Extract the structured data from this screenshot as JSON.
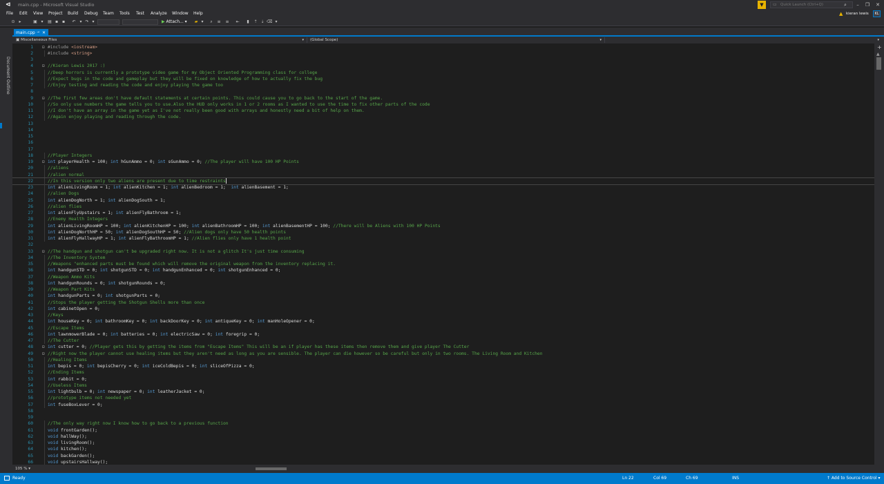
{
  "window": {
    "title": "main.cpp - Microsoft Visual Studio",
    "quick_launch_placeholder": "Quick Launch (Ctrl+Q)",
    "user_name": "kieran lewis",
    "user_initials": "KL",
    "controls": {
      "minimize": "–",
      "restore": "❐",
      "close": "✕"
    }
  },
  "menu": [
    "File",
    "Edit",
    "View",
    "Project",
    "Build",
    "Debug",
    "Team",
    "Tools",
    "Test",
    "Analyze",
    "Window",
    "Help"
  ],
  "toolbar": {
    "attach_label": "Attach..."
  },
  "side_panel": {
    "label": "Document Outline"
  },
  "tab": {
    "label": "main.cpp",
    "pin": "⊸",
    "close": "✕"
  },
  "navigation": {
    "project": "Miscellaneous Files",
    "scope": "(Global Scope)"
  },
  "editor": {
    "current_line": 22,
    "lines": [
      {
        "n": 1,
        "fold": "⊟",
        "tokens": [
          [
            "pp",
            "#include "
          ],
          [
            "st",
            "<iostream>"
          ]
        ]
      },
      {
        "n": 2,
        "fold": "",
        "tokens": [
          [
            "pp",
            "#include "
          ],
          [
            "st",
            "<string>"
          ]
        ]
      },
      {
        "n": 3,
        "fold": "",
        "tokens": []
      },
      {
        "n": 4,
        "fold": "⊟",
        "tokens": [
          [
            "cm",
            "//Kieran Lewis 2017 :)"
          ]
        ]
      },
      {
        "n": 5,
        "fold": "",
        "tokens": [
          [
            "cm",
            "//Deep horrors is currently a prototype video game for my Object Oriented Programming class for college"
          ]
        ]
      },
      {
        "n": 6,
        "fold": "",
        "tokens": [
          [
            "cm",
            "//Expect bugs in the code and gameplay but they will be fixed on knowledge of how to actually fix the bug"
          ]
        ]
      },
      {
        "n": 7,
        "fold": "",
        "tokens": [
          [
            "cm",
            "//Enjoy testing and reading the code and enjoy playing the game too"
          ]
        ]
      },
      {
        "n": 8,
        "fold": "",
        "tokens": []
      },
      {
        "n": 9,
        "fold": "⊟",
        "tokens": [
          [
            "cm",
            "//The first few areas don't have default statements at certain points. This could cause you to go back to the start of the game."
          ]
        ]
      },
      {
        "n": 10,
        "fold": "",
        "tokens": [
          [
            "cm",
            "//So only use numbers the game tells you to use.Also the HUD only works in 1 or 2 rooms as I wanted to use the time to fix other parts of the code"
          ]
        ]
      },
      {
        "n": 11,
        "fold": "",
        "tokens": [
          [
            "cm",
            "//I don't have an array in the game yet as I've not really been good with arrays and honestly need a bit of help on them."
          ]
        ]
      },
      {
        "n": 12,
        "fold": "",
        "tokens": [
          [
            "cm",
            "//Again enjoy playing and reading through the code."
          ]
        ]
      },
      {
        "n": 13,
        "fold": "",
        "tokens": []
      },
      {
        "n": 14,
        "fold": "",
        "tokens": []
      },
      {
        "n": 15,
        "fold": "",
        "tokens": []
      },
      {
        "n": 16,
        "fold": "",
        "tokens": []
      },
      {
        "n": 17,
        "fold": "",
        "tokens": []
      },
      {
        "n": 18,
        "fold": "",
        "tokens": [
          [
            "cm",
            "//Player Integers"
          ]
        ]
      },
      {
        "n": 19,
        "fold": "⊟",
        "tokens": [
          [
            "kw",
            "int"
          ],
          [
            "pl",
            " playerHealth = 100; "
          ],
          [
            "kw",
            "int"
          ],
          [
            "pl",
            " hGunAmmo = 0; "
          ],
          [
            "kw",
            "int"
          ],
          [
            "pl",
            " sGunAmmo = 0; "
          ],
          [
            "cm",
            "//The player will have 100 HP Points"
          ]
        ]
      },
      {
        "n": 20,
        "fold": "",
        "tokens": [
          [
            "cm",
            "//aliens"
          ]
        ]
      },
      {
        "n": 21,
        "fold": "",
        "tokens": [
          [
            "cm",
            "//alien normal"
          ]
        ]
      },
      {
        "n": 22,
        "fold": "",
        "tokens": [
          [
            "cm",
            "//In this version only two aliens are present due to time restraints"
          ]
        ]
      },
      {
        "n": 23,
        "fold": "",
        "tokens": [
          [
            "kw",
            "int"
          ],
          [
            "pl",
            " alienLivingRoom = 1; "
          ],
          [
            "kw",
            "int"
          ],
          [
            "pl",
            " alienKitchen = 1; "
          ],
          [
            "kw",
            "int"
          ],
          [
            "pl",
            " alienBedroom = 1;  "
          ],
          [
            "kw",
            "int"
          ],
          [
            "pl",
            " alienBasement = 1;"
          ]
        ]
      },
      {
        "n": 24,
        "fold": "",
        "tokens": [
          [
            "cm",
            "//alien Dogs"
          ]
        ]
      },
      {
        "n": 25,
        "fold": "",
        "tokens": [
          [
            "kw",
            "int"
          ],
          [
            "pl",
            " alienDogNorth = 1; "
          ],
          [
            "kw",
            "int"
          ],
          [
            "pl",
            " alienDogSouth = 1;"
          ]
        ]
      },
      {
        "n": 26,
        "fold": "",
        "tokens": [
          [
            "cm",
            "//alien flies"
          ]
        ]
      },
      {
        "n": 27,
        "fold": "",
        "tokens": [
          [
            "kw",
            "int"
          ],
          [
            "pl",
            " alienFlyUpstairs = 1; "
          ],
          [
            "kw",
            "int"
          ],
          [
            "pl",
            " alienFlyBathroom = 1;"
          ]
        ]
      },
      {
        "n": 28,
        "fold": "",
        "tokens": [
          [
            "cm",
            "//Enemy Health Integers"
          ]
        ]
      },
      {
        "n": 29,
        "fold": "",
        "tokens": [
          [
            "kw",
            "int"
          ],
          [
            "pl",
            " alienLivingRoomHP = 100; "
          ],
          [
            "kw",
            "int"
          ],
          [
            "pl",
            " alienKitchenHP = 100; "
          ],
          [
            "kw",
            "int"
          ],
          [
            "pl",
            " alienBathroomHP = 100; "
          ],
          [
            "kw",
            "int"
          ],
          [
            "pl",
            " alienBasementHP = 100; "
          ],
          [
            "cm",
            "//There will be Aliens with 100 HP Points"
          ]
        ]
      },
      {
        "n": 30,
        "fold": "",
        "tokens": [
          [
            "kw",
            "int"
          ],
          [
            "pl",
            " alienDogNorthHP = 50; "
          ],
          [
            "kw",
            "int"
          ],
          [
            "pl",
            " alienDogSouthHP = 50; "
          ],
          [
            "cm",
            "//Alien dogs only have 50 health points"
          ]
        ]
      },
      {
        "n": 31,
        "fold": "",
        "tokens": [
          [
            "kw",
            "int"
          ],
          [
            "pl",
            " alienFlyHallwayHP = 1; "
          ],
          [
            "kw",
            "int"
          ],
          [
            "pl",
            " alienFlyBathroomHP = 1; "
          ],
          [
            "cm",
            "//Alien flies only have 1 health point"
          ]
        ]
      },
      {
        "n": 32,
        "fold": "",
        "tokens": []
      },
      {
        "n": 33,
        "fold": "⊟",
        "tokens": [
          [
            "cm",
            "//The handgun and shotgun can't be upgraded right now. It is not a glitch It's just time consuming"
          ]
        ]
      },
      {
        "n": 34,
        "fold": "",
        "tokens": [
          [
            "cm",
            "//The Inventory System"
          ]
        ]
      },
      {
        "n": 35,
        "fold": "",
        "tokens": [
          [
            "cm",
            "//Weapons \"enhanced parts must be found which will remove the original weapon from the inventory replacing it."
          ]
        ]
      },
      {
        "n": 36,
        "fold": "",
        "tokens": [
          [
            "kw",
            "int"
          ],
          [
            "pl",
            " handgunSTD = 0; "
          ],
          [
            "kw",
            "int"
          ],
          [
            "pl",
            " shotgunSTD = 0; "
          ],
          [
            "kw",
            "int"
          ],
          [
            "pl",
            " handgunEnhanced = 0; "
          ],
          [
            "kw",
            "int"
          ],
          [
            "pl",
            " shotgunEnhanced = 0;"
          ]
        ]
      },
      {
        "n": 37,
        "fold": "",
        "tokens": [
          [
            "cm",
            "//Weapon Ammo Kits"
          ]
        ]
      },
      {
        "n": 38,
        "fold": "",
        "tokens": [
          [
            "kw",
            "int"
          ],
          [
            "pl",
            " handgunRounds = 0; "
          ],
          [
            "kw",
            "int"
          ],
          [
            "pl",
            " shotgunRounds = 0;"
          ]
        ]
      },
      {
        "n": 39,
        "fold": "",
        "tokens": [
          [
            "cm",
            "//Weapon Part Kits"
          ]
        ]
      },
      {
        "n": 40,
        "fold": "",
        "tokens": [
          [
            "kw",
            "int"
          ],
          [
            "pl",
            " handgunParts = 0; "
          ],
          [
            "kw",
            "int"
          ],
          [
            "pl",
            " shotgunParts = 0;"
          ]
        ]
      },
      {
        "n": 41,
        "fold": "",
        "tokens": [
          [
            "cm",
            "//Stops the player getting the Shotgun Shells more than once"
          ]
        ]
      },
      {
        "n": 42,
        "fold": "",
        "tokens": [
          [
            "kw",
            "int"
          ],
          [
            "pl",
            " cabinetOpen = 0;"
          ]
        ]
      },
      {
        "n": 43,
        "fold": "",
        "tokens": [
          [
            "cm",
            "//Keys"
          ]
        ]
      },
      {
        "n": 44,
        "fold": "",
        "tokens": [
          [
            "kw",
            "int"
          ],
          [
            "pl",
            " houseKey = 0; "
          ],
          [
            "kw",
            "int"
          ],
          [
            "pl",
            " bathroomKey = 0; "
          ],
          [
            "kw",
            "int"
          ],
          [
            "pl",
            " backDoorKey = 0; "
          ],
          [
            "kw",
            "int"
          ],
          [
            "pl",
            " antiqueKey = 0; "
          ],
          [
            "kw",
            "int"
          ],
          [
            "pl",
            " manHoleOpener = 0;"
          ]
        ]
      },
      {
        "n": 45,
        "fold": "",
        "tokens": [
          [
            "cm",
            "//Escape Items"
          ]
        ]
      },
      {
        "n": 46,
        "fold": "",
        "tokens": [
          [
            "kw",
            "int"
          ],
          [
            "pl",
            " lawnmowerBlade = 0; "
          ],
          [
            "kw",
            "int"
          ],
          [
            "pl",
            " batteries = 0; "
          ],
          [
            "kw",
            "int"
          ],
          [
            "pl",
            " electricSaw = 0; "
          ],
          [
            "kw",
            "int"
          ],
          [
            "pl",
            " foregrip = 0;"
          ]
        ]
      },
      {
        "n": 47,
        "fold": "",
        "tokens": [
          [
            "cm",
            "//The Cutter"
          ]
        ]
      },
      {
        "n": 48,
        "fold": "⊟",
        "tokens": [
          [
            "kw",
            "int"
          ],
          [
            "pl",
            " cutter = 0; "
          ],
          [
            "cm",
            "//Player gets this by getting the items from \"Escape Items\" This will be an if player has these items then remove them and give player The Cutter"
          ]
        ]
      },
      {
        "n": 49,
        "fold": "⊟",
        "tokens": [
          [
            "cm",
            "//Right now the player cannot use healing items but they aren't need as long as you are sensible. The player can die however so be careful but only in two rooms. The Living Room and Kitchen"
          ]
        ]
      },
      {
        "n": 50,
        "fold": "",
        "tokens": [
          [
            "cm",
            "//Healing Items"
          ]
        ]
      },
      {
        "n": 51,
        "fold": "",
        "tokens": [
          [
            "kw",
            "int"
          ],
          [
            "pl",
            " bepis = 0; "
          ],
          [
            "kw",
            "int"
          ],
          [
            "pl",
            " bepisCherry = 0; "
          ],
          [
            "kw",
            "int"
          ],
          [
            "pl",
            " iceColdBepis = 0; "
          ],
          [
            "kw",
            "int"
          ],
          [
            "pl",
            " sliceOfPizza = 0;"
          ]
        ]
      },
      {
        "n": 52,
        "fold": "",
        "tokens": [
          [
            "cm",
            "//Ending Items"
          ]
        ]
      },
      {
        "n": 53,
        "fold": "",
        "tokens": [
          [
            "kw",
            "int"
          ],
          [
            "pl",
            " rabbit = 0;"
          ]
        ]
      },
      {
        "n": 54,
        "fold": "",
        "tokens": [
          [
            "cm",
            "//Useless Items"
          ]
        ]
      },
      {
        "n": 55,
        "fold": "",
        "tokens": [
          [
            "kw",
            "int"
          ],
          [
            "pl",
            " lightbulb = 0; "
          ],
          [
            "kw",
            "int"
          ],
          [
            "pl",
            " newspaper = 0; "
          ],
          [
            "kw",
            "int"
          ],
          [
            "pl",
            " leatherJacket = 0;"
          ]
        ]
      },
      {
        "n": 56,
        "fold": "",
        "tokens": [
          [
            "cm",
            "//prototype items not needed yet"
          ]
        ]
      },
      {
        "n": 57,
        "fold": "",
        "tokens": [
          [
            "kw",
            "int"
          ],
          [
            "pl",
            " fuseBoxLever = 0;"
          ]
        ]
      },
      {
        "n": 58,
        "fold": "",
        "tokens": []
      },
      {
        "n": 59,
        "fold": "",
        "tokens": []
      },
      {
        "n": 60,
        "fold": "",
        "tokens": [
          [
            "cm",
            "//The only way right now I know how to go back to a previous function"
          ]
        ]
      },
      {
        "n": 61,
        "fold": "",
        "tokens": [
          [
            "kw",
            "void"
          ],
          [
            "pl",
            " frontGarden();"
          ]
        ]
      },
      {
        "n": 62,
        "fold": "",
        "tokens": [
          [
            "kw",
            "void"
          ],
          [
            "pl",
            " hallWay();"
          ]
        ]
      },
      {
        "n": 63,
        "fold": "",
        "tokens": [
          [
            "kw",
            "void"
          ],
          [
            "pl",
            " livingRoom();"
          ]
        ]
      },
      {
        "n": 64,
        "fold": "",
        "tokens": [
          [
            "kw",
            "void"
          ],
          [
            "pl",
            " kitchen();"
          ]
        ]
      },
      {
        "n": 65,
        "fold": "",
        "tokens": [
          [
            "kw",
            "void"
          ],
          [
            "pl",
            " backGarden();"
          ]
        ]
      },
      {
        "n": 66,
        "fold": "",
        "tokens": [
          [
            "kw",
            "void"
          ],
          [
            "pl",
            " upstairsHallway();"
          ]
        ]
      }
    ]
  },
  "zoom": {
    "level": "105 %"
  },
  "status": {
    "state": "Ready",
    "line": "Ln 22",
    "col": "Col 69",
    "ch": "Ch 69",
    "mode": "INS",
    "source_control": "↑ Add to Source Control ▾"
  },
  "colors": {
    "accent": "#007acc",
    "keyword": "#569cd6",
    "comment": "#57a64a",
    "string": "#d69d85",
    "line_number": "#2b91af"
  }
}
